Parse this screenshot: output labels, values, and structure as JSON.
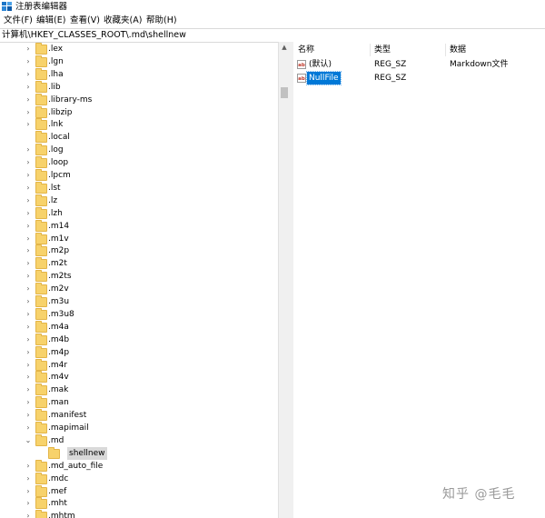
{
  "window": {
    "title": "注册表编辑器"
  },
  "menu": [
    "文件(F)",
    "编辑(E)",
    "查看(V)",
    "收藏夹(A)",
    "帮助(H)"
  ],
  "address": "计算机\\HKEY_CLASSES_ROOT\\.md\\shellnew",
  "tree": [
    {
      "label": ".lex",
      "expander": ">"
    },
    {
      "label": ".lgn",
      "expander": ">"
    },
    {
      "label": ".lha",
      "expander": ">"
    },
    {
      "label": ".lib",
      "expander": ">"
    },
    {
      "label": ".library-ms",
      "expander": ">"
    },
    {
      "label": ".libzip",
      "expander": ">"
    },
    {
      "label": ".lnk",
      "expander": ">"
    },
    {
      "label": ".local",
      "expander": ""
    },
    {
      "label": ".log",
      "expander": ">"
    },
    {
      "label": ".loop",
      "expander": ">"
    },
    {
      "label": ".lpcm",
      "expander": ">"
    },
    {
      "label": ".lst",
      "expander": ">"
    },
    {
      "label": ".lz",
      "expander": ">"
    },
    {
      "label": ".lzh",
      "expander": ">"
    },
    {
      "label": ".m14",
      "expander": ">"
    },
    {
      "label": ".m1v",
      "expander": ">"
    },
    {
      "label": ".m2p",
      "expander": ">"
    },
    {
      "label": ".m2t",
      "expander": ">"
    },
    {
      "label": ".m2ts",
      "expander": ">"
    },
    {
      "label": ".m2v",
      "expander": ">"
    },
    {
      "label": ".m3u",
      "expander": ">"
    },
    {
      "label": ".m3u8",
      "expander": ">"
    },
    {
      "label": ".m4a",
      "expander": ">"
    },
    {
      "label": ".m4b",
      "expander": ">"
    },
    {
      "label": ".m4p",
      "expander": ">"
    },
    {
      "label": ".m4r",
      "expander": ">"
    },
    {
      "label": ".m4v",
      "expander": ">"
    },
    {
      "label": ".mak",
      "expander": ">"
    },
    {
      "label": ".man",
      "expander": ">"
    },
    {
      "label": ".manifest",
      "expander": ">"
    },
    {
      "label": ".mapimail",
      "expander": ">"
    },
    {
      "label": ".md",
      "expander": "v"
    },
    {
      "label": "shellnew",
      "expander": "",
      "child": true,
      "selected": true
    },
    {
      "label": ".md_auto_file",
      "expander": ">"
    },
    {
      "label": ".mdc",
      "expander": ">"
    },
    {
      "label": ".mef",
      "expander": ">"
    },
    {
      "label": ".mht",
      "expander": ">"
    },
    {
      "label": ".mhtm",
      "expander": ">"
    }
  ],
  "values": {
    "headers": {
      "name": "名称",
      "type": "类型",
      "data": "数据"
    },
    "rows": [
      {
        "name": "(默认)",
        "type": "REG_SZ",
        "data": "Markdown文件",
        "icon": "ab"
      },
      {
        "name": "NullFile",
        "type": "REG_SZ",
        "data": "",
        "icon": "ab",
        "selected": true
      }
    ]
  },
  "watermark": "知乎 @毛毛"
}
